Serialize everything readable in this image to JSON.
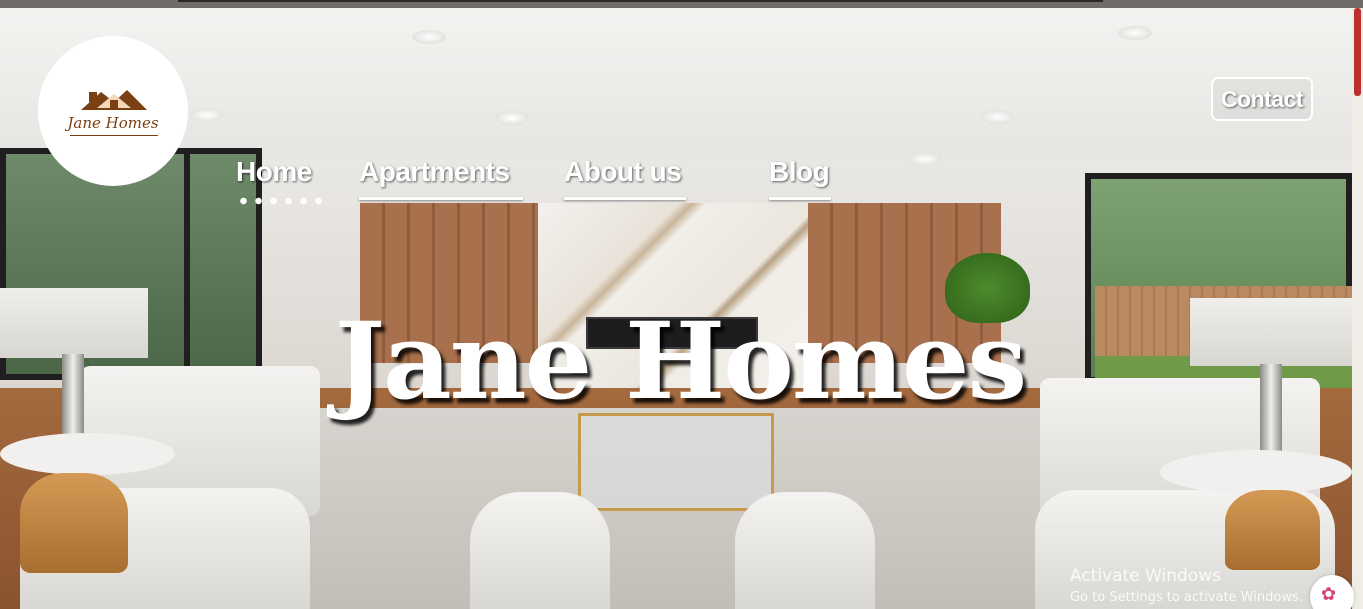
{
  "brand": {
    "logo_text": "Jane Homes",
    "logo_color": "#7a3f12"
  },
  "nav": {
    "items": [
      {
        "label": "Home",
        "active": true
      },
      {
        "label": "Apartments",
        "active": false
      },
      {
        "label": "About us",
        "active": false
      },
      {
        "label": "Blog",
        "active": false
      }
    ],
    "contact_label": "Contact"
  },
  "hero": {
    "title": "Jane Homes"
  },
  "system": {
    "activate_title": "Activate Windows",
    "activate_sub": "Go to Settings to activate Windows.",
    "assistant_icon": "brain-icon"
  },
  "colors": {
    "text_light": "#ffffff",
    "scroll_thumb": "#b8322b"
  }
}
